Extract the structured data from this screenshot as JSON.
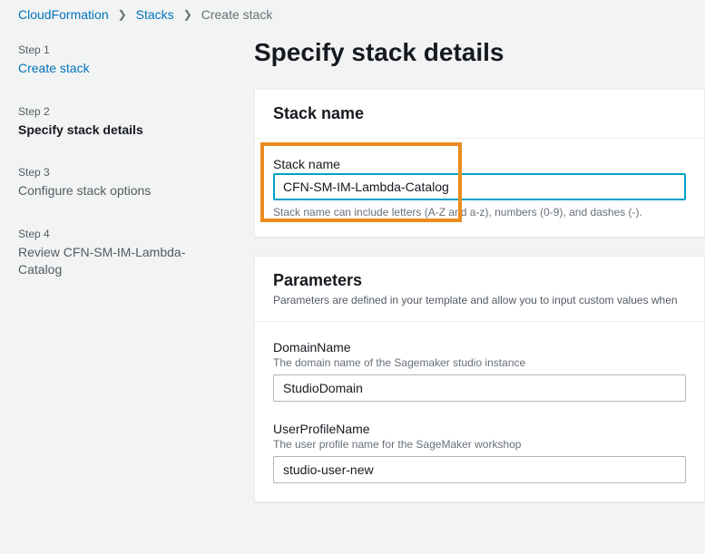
{
  "breadcrumb": {
    "items": [
      {
        "label": "CloudFormation",
        "link": true
      },
      {
        "label": "Stacks",
        "link": true
      },
      {
        "label": "Create stack",
        "link": false
      }
    ]
  },
  "sidebar": {
    "steps": [
      {
        "label": "Step 1",
        "title": "Create stack",
        "state": "link"
      },
      {
        "label": "Step 2",
        "title": "Specify stack details",
        "state": "active"
      },
      {
        "label": "Step 3",
        "title": "Configure stack options",
        "state": "pending"
      },
      {
        "label": "Step 4",
        "title": "Review CFN-SM-IM-Lambda-Catalog",
        "state": "pending"
      }
    ]
  },
  "main": {
    "title": "Specify stack details",
    "stack_name_panel": {
      "title": "Stack name",
      "field_label": "Stack name",
      "value": "CFN-SM-IM-Lambda-Catalog",
      "hint": "Stack name can include letters (A-Z and a-z), numbers (0-9), and dashes (-)."
    },
    "parameters_panel": {
      "title": "Parameters",
      "subtitle": "Parameters are defined in your template and allow you to input custom values when",
      "fields": [
        {
          "label": "DomainName",
          "desc": "The domain name of the Sagemaker studio instance",
          "value": "StudioDomain"
        },
        {
          "label": "UserProfileName",
          "desc": "The user profile name for the SageMaker workshop",
          "value": "studio-user-new"
        }
      ]
    }
  }
}
